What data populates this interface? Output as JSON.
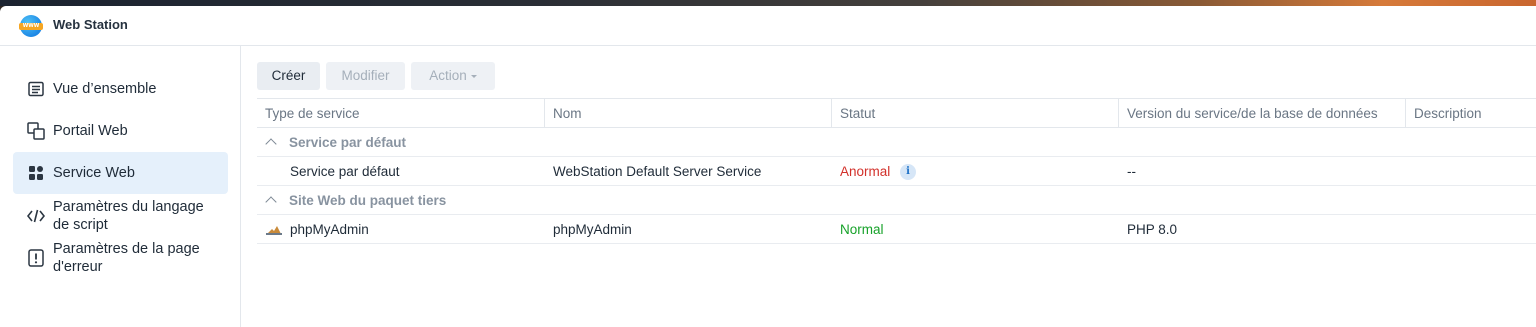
{
  "app": {
    "title": "Web Station",
    "icon": "webstation-globe-icon"
  },
  "sidebar": {
    "items": [
      {
        "label": "Vue d’ensemble",
        "icon": "overview-icon",
        "active": false
      },
      {
        "label": "Portail Web",
        "icon": "web-portal-icon",
        "active": false
      },
      {
        "label": "Service Web",
        "icon": "grid-apps-icon",
        "active": true
      },
      {
        "label_line1": "Paramètres du langage",
        "label_line2": "de script",
        "icon": "code-brackets-icon",
        "active": false
      },
      {
        "label_line1": "Paramètres de la page",
        "label_line2": "d'erreur",
        "icon": "error-page-icon",
        "active": false
      }
    ]
  },
  "toolbar": {
    "create_label": "Créer",
    "modify_label": "Modifier",
    "action_label": "Action"
  },
  "table": {
    "columns": [
      "Type de service",
      "Nom",
      "Statut",
      "Version du service/de la base de données",
      "Description"
    ],
    "groups": [
      {
        "label": "Service par défaut",
        "rows": [
          {
            "type": "Service par défaut",
            "name": "WebStation Default Server Service",
            "status": "Anormal",
            "status_kind": "error",
            "version": "--",
            "description": ""
          }
        ]
      },
      {
        "label": "Site Web du paquet tiers",
        "rows": [
          {
            "type": "phpMyAdmin",
            "name": "phpMyAdmin",
            "status": "Normal",
            "status_kind": "ok",
            "version": "PHP 8.0",
            "description": ""
          }
        ]
      }
    ]
  },
  "colors": {
    "accent": "#1b6fc6",
    "active_nav_bg": "#e5f0fb",
    "status_error": "#d2302a",
    "status_ok": "#17a22a"
  }
}
